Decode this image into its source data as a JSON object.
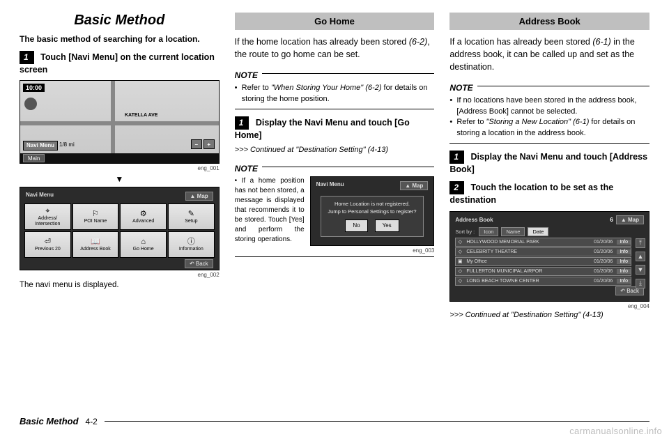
{
  "col1": {
    "title": "Basic Method",
    "intro": "The basic method of searching for a location.",
    "step1_num": "1",
    "step1_text": "Touch [Navi Menu] on the current location screen",
    "map": {
      "clock": "10:00",
      "road_label": "KATELLA AVE",
      "navi_btn": "Navi Menu",
      "scale": "1/8 mi",
      "zoom_out": "−",
      "zoom_in": "+",
      "main_btn": "Main",
      "img_id": "eng_001"
    },
    "arrow": "▼",
    "menu": {
      "title": "Navi Menu",
      "map_btn": "▲ Map",
      "cells": [
        {
          "icon": "⌖",
          "label": "Address/ Intersection"
        },
        {
          "icon": "⚐",
          "label": "POI Name"
        },
        {
          "icon": "⚙",
          "label": "Advanced"
        },
        {
          "icon": "✎",
          "label": "Setup"
        },
        {
          "icon": "⏎",
          "label": "Previous 20"
        },
        {
          "icon": "📖",
          "label": "Address Book"
        },
        {
          "icon": "⌂",
          "label": "Go Home"
        },
        {
          "icon": "ⓘ",
          "label": "Information"
        }
      ],
      "back": "↶ Back",
      "img_id": "eng_002"
    },
    "caption": "The navi menu is displayed."
  },
  "col2": {
    "section": "Go Home",
    "body": "If the home location has already been stored ",
    "body_ref": "(6-2)",
    "body2": ", the route to go home can be set.",
    "note_head": "NOTE",
    "note_items": [
      {
        "pre": "Refer to ",
        "ref": "\"When Storing Your Home\" (6-2)",
        "post": " for details on storing the home position."
      }
    ],
    "step1_num": "1",
    "step1_text": "Display the Navi Menu and touch [Go Home]",
    "cont": ">>> Continued at \"Destination Setting\" (4-13)",
    "note2_text": "If a home position has not been stored, a message is displayed that recommends it to be stored. Touch [Yes] and perform the storing operations.",
    "dialog": {
      "title": "Navi Menu",
      "map_btn": "▲ Map",
      "line1": "Home Location is not registered.",
      "line2": "Jump to Personal Settings to register?",
      "no": "No",
      "yes": "Yes",
      "img_id": "eng_003"
    }
  },
  "col3": {
    "section": "Address Book",
    "body": "If a location has already been stored ",
    "body_ref": "(6-1)",
    "body2": " in the address book, it can be called up and set as the destination.",
    "note_head": "NOTE",
    "note_items": [
      {
        "pre": "If no locations have been stored in the address book, [Address Book] cannot be selected.",
        "ref": "",
        "post": ""
      },
      {
        "pre": "Refer to ",
        "ref": "\"Storing a New Location\" (6-1)",
        "post": " for details on storing a location in the address book."
      }
    ],
    "step1_num": "1",
    "step1_text": "Display the Navi Menu and touch [Address Book]",
    "step2_num": "2",
    "step2_text": "Touch the location to be set as the destination",
    "book": {
      "title": "Address Book",
      "page": "6",
      "map_btn": "▲ Map",
      "sort_label": "Sort by :",
      "sort_options": [
        "Icon",
        "Name",
        "Date"
      ],
      "sort_active": 2,
      "rows": [
        {
          "icon": "◇",
          "name": "HOLLYWOOD MEMORIAL PARK",
          "date": "01/20/06",
          "info": "Info"
        },
        {
          "icon": "◇",
          "name": "CELEBRITY THEATRE",
          "date": "01/20/06",
          "info": "Info"
        },
        {
          "icon": "▣",
          "name": "My Office",
          "date": "01/20/06",
          "info": "Info"
        },
        {
          "icon": "◇",
          "name": "FULLERTON MUNICIPAL AIRPOR",
          "date": "01/20/06",
          "info": "Info"
        },
        {
          "icon": "◇",
          "name": "LONG BEACH TOWNE CENTER",
          "date": "01/20/06",
          "info": "Info"
        }
      ],
      "scroll": [
        "⤒",
        "▲",
        "▼",
        "⤓"
      ],
      "back": "↶ Back",
      "img_id": "eng_004"
    },
    "cont": ">>> Continued at \"Destination Setting\" (4-13)"
  },
  "footer": {
    "section": "Basic Method",
    "page": "4-2"
  },
  "watermark": "carmanualsonline.info"
}
